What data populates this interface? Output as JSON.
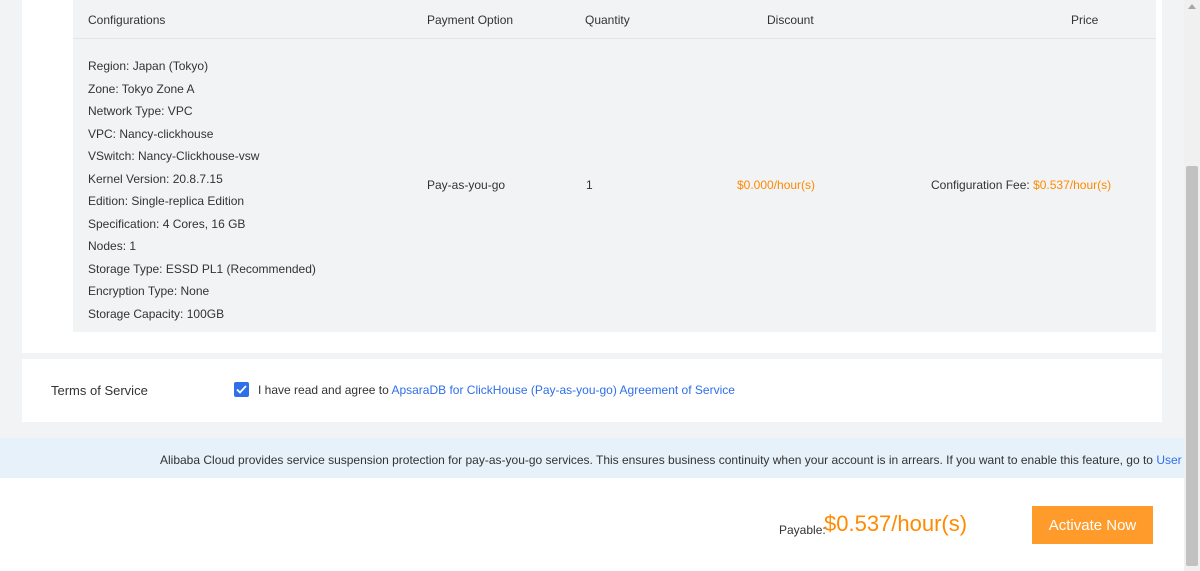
{
  "table": {
    "headers": {
      "configurations": "Configurations",
      "payment_option": "Payment Option",
      "quantity": "Quantity",
      "discount": "Discount",
      "price": "Price"
    },
    "configurations": [
      "Region: Japan (Tokyo)",
      "Zone: Tokyo Zone A",
      "Network Type: VPC",
      "VPC: Nancy-clickhouse",
      "VSwitch: Nancy-Clickhouse-vsw",
      "Kernel Version: 20.8.7.15",
      "Edition: Single-replica Edition",
      "Specification: 4 Cores, 16 GB",
      "Nodes: 1",
      "Storage Type: ESSD PL1 (Recommended)",
      "Encryption Type: None",
      "Storage Capacity: 100GB"
    ],
    "payment_option": "Pay-as-you-go",
    "quantity": "1",
    "discount": "$0.000/hour(s)",
    "price_label": "Configuration Fee: ",
    "price_value": "$0.537/hour(s)"
  },
  "terms": {
    "title": "Terms of Service",
    "checked": true,
    "agree_text": "I have read and agree to ",
    "agreement_link": "ApsaraDB for ClickHouse (Pay-as-you-go) Agreement of Service"
  },
  "notice": {
    "text": "Alibaba Cloud provides service suspension protection for pay-as-you-go services. This ensures business continuity when your account is in arrears. If you want to enable this feature, go to ",
    "link": "User Center",
    "suffix": "."
  },
  "footer": {
    "payable_label": "Payable: ",
    "payable_amount": "$0.537/hour(s)",
    "activate_label": "Activate Now"
  },
  "colors": {
    "accent_orange": "#ff8a00",
    "button_orange": "#ff9b2b",
    "link_blue": "#2f6fe8",
    "notice_bg": "#e6f1fa"
  },
  "icons": {
    "checkbox": "check-icon",
    "scroll_up": "triangle-up-icon"
  }
}
